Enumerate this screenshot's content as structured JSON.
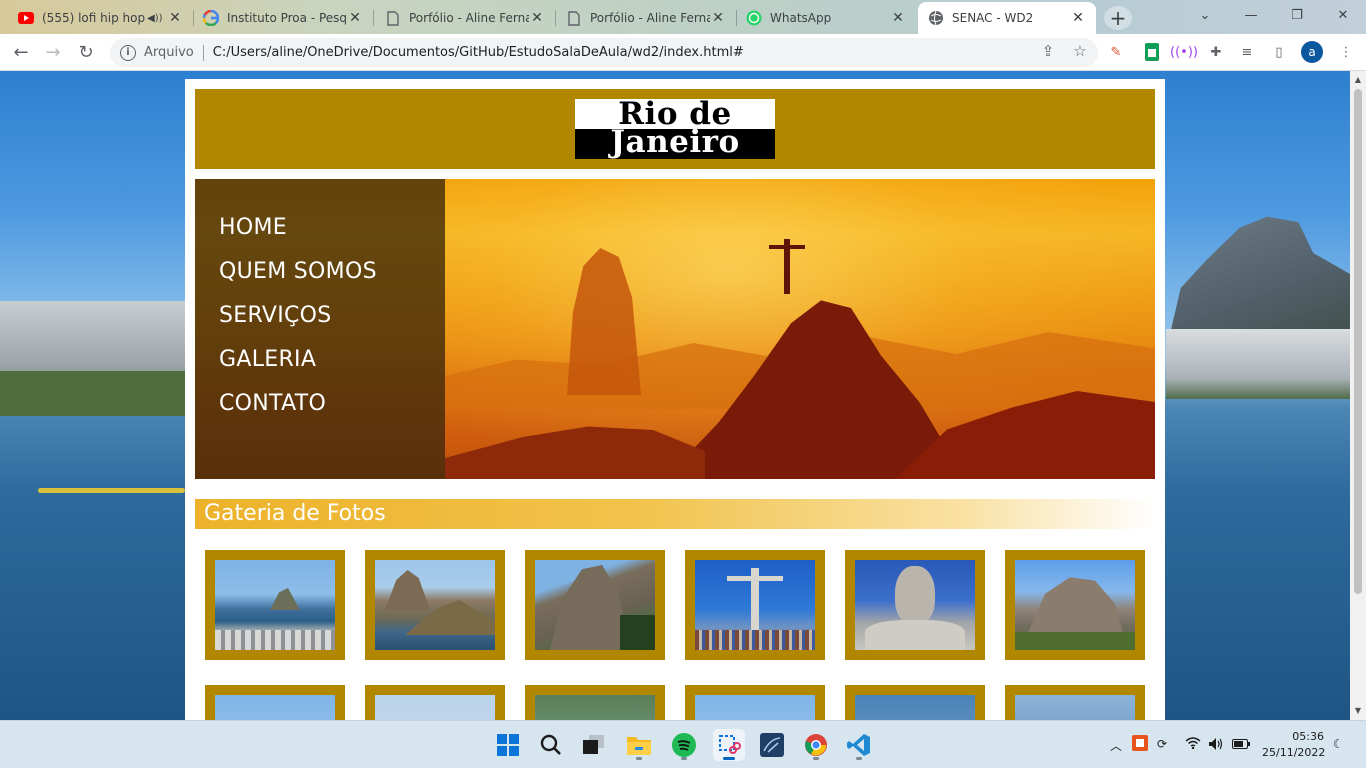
{
  "browser": {
    "tabs": [
      {
        "title": "(555) lofi hip hop",
        "icon": "youtube-icon",
        "audio": true
      },
      {
        "title": "Instituto Proa - Pesqu",
        "icon": "google-icon"
      },
      {
        "title": "Porfólio - Aline Fernar",
        "icon": "page-icon"
      },
      {
        "title": "Porfólio - Aline Fernar",
        "icon": "page-icon"
      },
      {
        "title": "WhatsApp",
        "icon": "whatsapp-icon"
      },
      {
        "title": "SENAC - WD2",
        "icon": "globe-icon",
        "active": true
      }
    ],
    "address": {
      "scheme_label": "Arquivo",
      "url": "C:/Users/aline/OneDrive/Documentos/GitHub/EstudoSalaDeAula/wd2/index.html#"
    },
    "profile_initial": "a"
  },
  "page": {
    "logo": {
      "line1": "Rio de",
      "line2": "Janeiro"
    },
    "menu": [
      "HOME",
      "QUEM SOMOS",
      "SERVIÇOS",
      "GALERIA",
      "CONTATO"
    ],
    "gallery_title": "Gateria de Fotos",
    "gallery": [
      {
        "name": "botafogo-view"
      },
      {
        "name": "sugarloaf-bay"
      },
      {
        "name": "sugarloaf-rock"
      },
      {
        "name": "christ-redeemer-crowd"
      },
      {
        "name": "christ-redeemer-face"
      },
      {
        "name": "pedra-da-gavea"
      },
      {
        "name": "photo-7"
      },
      {
        "name": "photo-8"
      },
      {
        "name": "photo-9"
      },
      {
        "name": "photo-10"
      },
      {
        "name": "photo-11"
      },
      {
        "name": "photo-12"
      }
    ],
    "colors": {
      "header": "#b28700",
      "gallery_title": "#edb22a",
      "menu_text": "#ffffff"
    }
  },
  "taskbar": {
    "apps": [
      "start-icon",
      "search-icon",
      "task-view-icon",
      "file-explorer-icon",
      "spotify-icon",
      "snipping-tool-icon",
      "mysql-workbench-icon",
      "chrome-icon",
      "vscode-icon"
    ],
    "tray": [
      "chevron-up-icon",
      "office-icon",
      "sync-icon",
      "wifi-icon",
      "speaker-icon",
      "battery-icon"
    ],
    "time": "05:36",
    "date": "25/11/2022"
  }
}
